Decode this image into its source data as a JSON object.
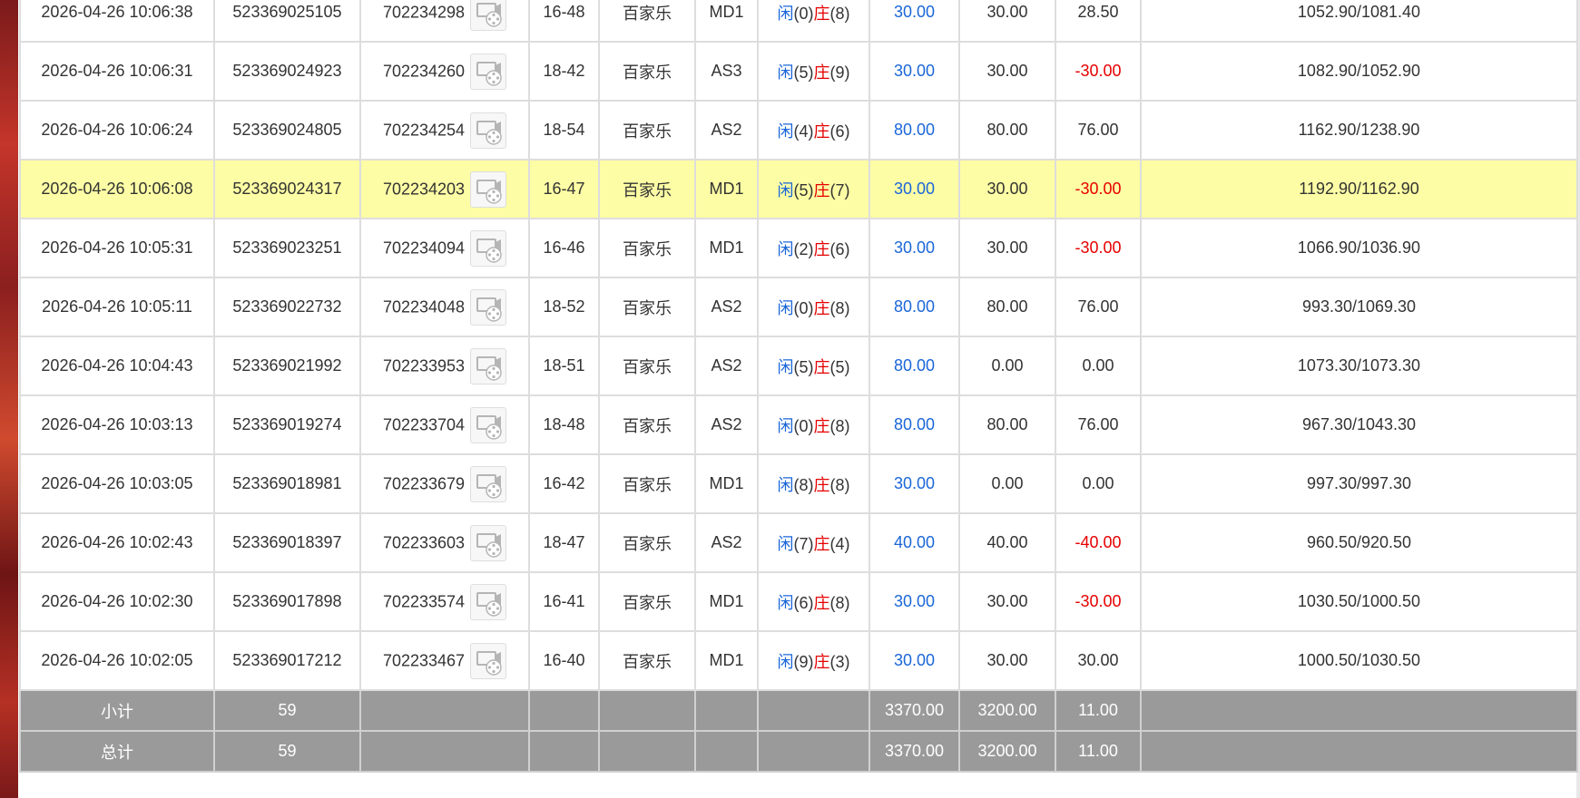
{
  "colors": {
    "highlight_row": "#fdfda5",
    "summary_bg": "#9a9a9a",
    "bet_blue": "#1a66d8",
    "loss_red": "#e60000"
  },
  "icons": {
    "replay": "video-replay-icon"
  },
  "rows": [
    {
      "time": "2026-04-26 10:06:38",
      "bet_no": "523369025105",
      "round_id": "702234298",
      "table": "16-48",
      "game": "百家乐",
      "hall": "MD1",
      "player_label": "闲",
      "player_score": "(0)",
      "banker_label": "庄",
      "banker_score": "(8)",
      "bet": "30.00",
      "valid_bet": "30.00",
      "win_loss": "28.50",
      "win_loss_negative": false,
      "balance": "1052.90/1081.40",
      "highlight": false
    },
    {
      "time": "2026-04-26 10:06:31",
      "bet_no": "523369024923",
      "round_id": "702234260",
      "table": "18-42",
      "game": "百家乐",
      "hall": "AS3",
      "player_label": "闲",
      "player_score": "(5)",
      "banker_label": "庄",
      "banker_score": "(9)",
      "bet": "30.00",
      "valid_bet": "30.00",
      "win_loss": "-30.00",
      "win_loss_negative": true,
      "balance": "1082.90/1052.90",
      "highlight": false
    },
    {
      "time": "2026-04-26 10:06:24",
      "bet_no": "523369024805",
      "round_id": "702234254",
      "table": "18-54",
      "game": "百家乐",
      "hall": "AS2",
      "player_label": "闲",
      "player_score": "(4)",
      "banker_label": "庄",
      "banker_score": "(6)",
      "bet": "80.00",
      "valid_bet": "80.00",
      "win_loss": "76.00",
      "win_loss_negative": false,
      "balance": "1162.90/1238.90",
      "highlight": false
    },
    {
      "time": "2026-04-26 10:06:08",
      "bet_no": "523369024317",
      "round_id": "702234203",
      "table": "16-47",
      "game": "百家乐",
      "hall": "MD1",
      "player_label": "闲",
      "player_score": "(5)",
      "banker_label": "庄",
      "banker_score": "(7)",
      "bet": "30.00",
      "valid_bet": "30.00",
      "win_loss": "-30.00",
      "win_loss_negative": true,
      "balance": "1192.90/1162.90",
      "highlight": true
    },
    {
      "time": "2026-04-26 10:05:31",
      "bet_no": "523369023251",
      "round_id": "702234094",
      "table": "16-46",
      "game": "百家乐",
      "hall": "MD1",
      "player_label": "闲",
      "player_score": "(2)",
      "banker_label": "庄",
      "banker_score": "(6)",
      "bet": "30.00",
      "valid_bet": "30.00",
      "win_loss": "-30.00",
      "win_loss_negative": true,
      "balance": "1066.90/1036.90",
      "highlight": false
    },
    {
      "time": "2026-04-26 10:05:11",
      "bet_no": "523369022732",
      "round_id": "702234048",
      "table": "18-52",
      "game": "百家乐",
      "hall": "AS2",
      "player_label": "闲",
      "player_score": "(0)",
      "banker_label": "庄",
      "banker_score": "(8)",
      "bet": "80.00",
      "valid_bet": "80.00",
      "win_loss": "76.00",
      "win_loss_negative": false,
      "balance": "993.30/1069.30",
      "highlight": false
    },
    {
      "time": "2026-04-26 10:04:43",
      "bet_no": "523369021992",
      "round_id": "702233953",
      "table": "18-51",
      "game": "百家乐",
      "hall": "AS2",
      "player_label": "闲",
      "player_score": "(5)",
      "banker_label": "庄",
      "banker_score": "(5)",
      "bet": "80.00",
      "valid_bet": "0.00",
      "win_loss": "0.00",
      "win_loss_negative": false,
      "balance": "1073.30/1073.30",
      "highlight": false
    },
    {
      "time": "2026-04-26 10:03:13",
      "bet_no": "523369019274",
      "round_id": "702233704",
      "table": "18-48",
      "game": "百家乐",
      "hall": "AS2",
      "player_label": "闲",
      "player_score": "(0)",
      "banker_label": "庄",
      "banker_score": "(8)",
      "bet": "80.00",
      "valid_bet": "80.00",
      "win_loss": "76.00",
      "win_loss_negative": false,
      "balance": "967.30/1043.30",
      "highlight": false
    },
    {
      "time": "2026-04-26 10:03:05",
      "bet_no": "523369018981",
      "round_id": "702233679",
      "table": "16-42",
      "game": "百家乐",
      "hall": "MD1",
      "player_label": "闲",
      "player_score": "(8)",
      "banker_label": "庄",
      "banker_score": "(8)",
      "bet": "30.00",
      "valid_bet": "0.00",
      "win_loss": "0.00",
      "win_loss_negative": false,
      "balance": "997.30/997.30",
      "highlight": false
    },
    {
      "time": "2026-04-26 10:02:43",
      "bet_no": "523369018397",
      "round_id": "702233603",
      "table": "18-47",
      "game": "百家乐",
      "hall": "AS2",
      "player_label": "闲",
      "player_score": "(7)",
      "banker_label": "庄",
      "banker_score": "(4)",
      "bet": "40.00",
      "valid_bet": "40.00",
      "win_loss": "-40.00",
      "win_loss_negative": true,
      "balance": "960.50/920.50",
      "highlight": false
    },
    {
      "time": "2026-04-26 10:02:30",
      "bet_no": "523369017898",
      "round_id": "702233574",
      "table": "16-41",
      "game": "百家乐",
      "hall": "MD1",
      "player_label": "闲",
      "player_score": "(6)",
      "banker_label": "庄",
      "banker_score": "(8)",
      "bet": "30.00",
      "valid_bet": "30.00",
      "win_loss": "-30.00",
      "win_loss_negative": true,
      "balance": "1030.50/1000.50",
      "highlight": false
    },
    {
      "time": "2026-04-26 10:02:05",
      "bet_no": "523369017212",
      "round_id": "702233467",
      "table": "16-40",
      "game": "百家乐",
      "hall": "MD1",
      "player_label": "闲",
      "player_score": "(9)",
      "banker_label": "庄",
      "banker_score": "(3)",
      "bet": "30.00",
      "valid_bet": "30.00",
      "win_loss": "30.00",
      "win_loss_negative": false,
      "balance": "1000.50/1030.50",
      "highlight": false
    }
  ],
  "subtotal": {
    "label": "小计",
    "count": "59",
    "bet": "3370.00",
    "valid_bet": "3200.00",
    "win_loss": "11.00"
  },
  "total": {
    "label": "总计",
    "count": "59",
    "bet": "3370.00",
    "valid_bet": "3200.00",
    "win_loss": "11.00"
  }
}
